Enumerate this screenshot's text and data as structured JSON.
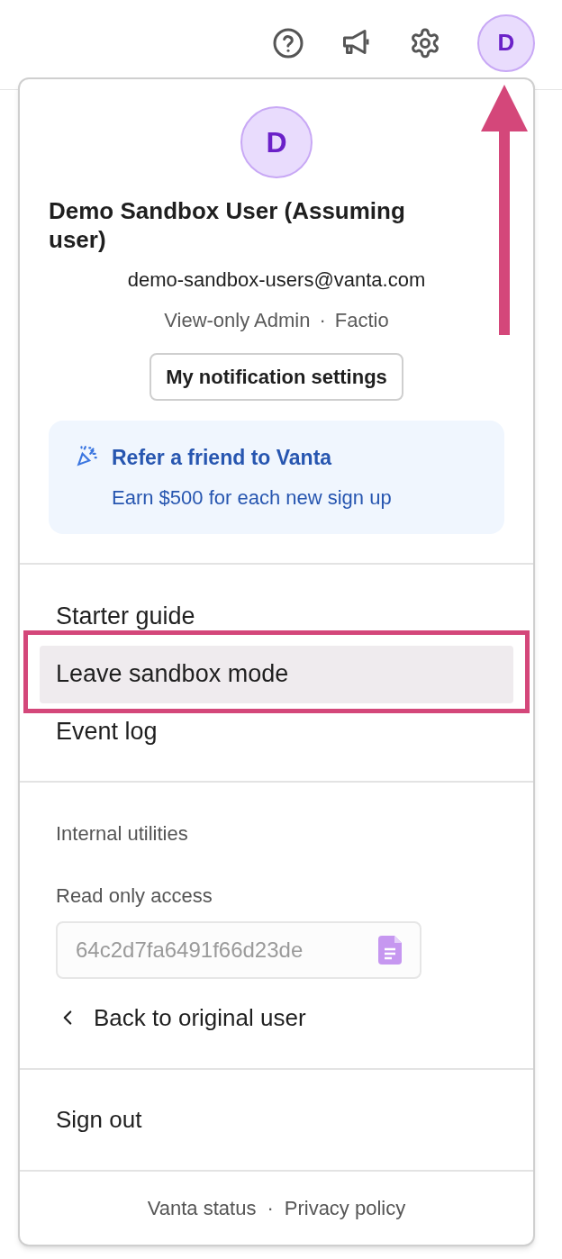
{
  "top_bar": {
    "avatar_letter": "D"
  },
  "profile": {
    "avatar_letter": "D",
    "name": "Demo Sandbox User (Assuming user)",
    "email": "demo-sandbox-users@vanta.com",
    "role": "View-only Admin",
    "separator": "·",
    "org": "Factio",
    "settings_button": "My notification settings"
  },
  "referral": {
    "title": "Refer a friend to Vanta",
    "subtitle": "Earn $500 for each new sign up"
  },
  "menu_items": [
    {
      "label": "Starter guide",
      "selected": false
    },
    {
      "label": "Leave sandbox mode",
      "selected": true
    },
    {
      "label": "Event log",
      "selected": false
    }
  ],
  "internal": {
    "heading": "Internal utilities",
    "field_label": "Read only access",
    "field_value": "64c2d7fa6491f66d23de",
    "back_link": "Back to original user"
  },
  "sign_out": "Sign out",
  "footer": {
    "links": [
      "Vanta status",
      "Privacy policy"
    ],
    "separator": "·"
  }
}
